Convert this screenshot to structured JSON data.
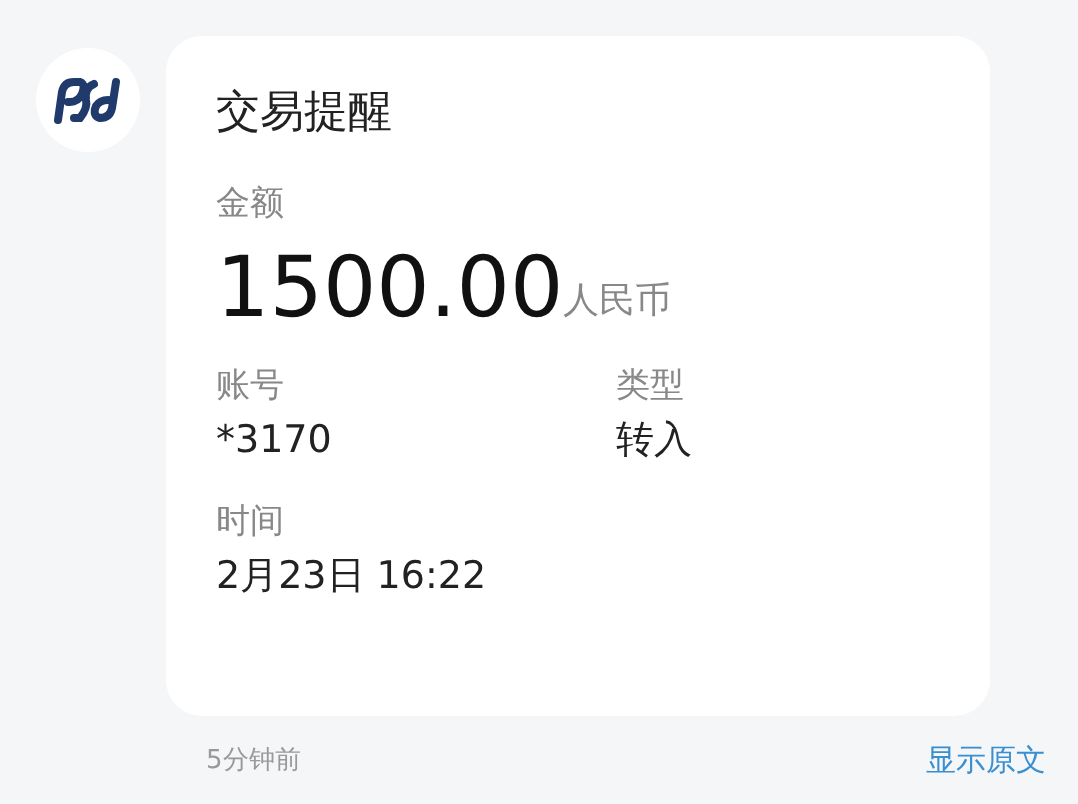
{
  "card": {
    "title": "交易提醒",
    "amount_label": "金额",
    "amount": "1500.00",
    "currency": "人民币",
    "fields": [
      {
        "label": "账号",
        "value": "*3170"
      },
      {
        "label": "类型",
        "value": "转入"
      }
    ],
    "time_label": "时间",
    "time": "2月23日 16:22"
  },
  "footer": {
    "time_ago": "5分钟前",
    "link": "显示原文"
  }
}
